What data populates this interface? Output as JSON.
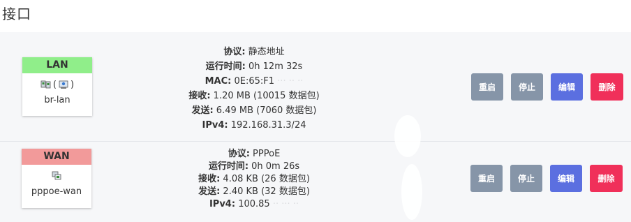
{
  "page": {
    "title": "接口"
  },
  "interfaces": [
    {
      "badge": "LAN",
      "device": "br-lan",
      "icons_suffix": "(",
      "icons_suffix_end": ")",
      "fields": [
        {
          "label": "协议:",
          "value": " 静态地址"
        },
        {
          "label": "运行时间:",
          "value": " 0h 12m 32s"
        },
        {
          "label": "MAC:",
          "value": " 0E:65:F1"
        },
        {
          "label": "接收:",
          "value": " 1.20 MB (10015 数据包)"
        },
        {
          "label": "发送:",
          "value": " 6.49 MB (7060 数据包)"
        },
        {
          "label": "IPv4:",
          "value": " 192.168.31.3/24"
        }
      ],
      "buttons": {
        "restart": "重启",
        "stop": "停止",
        "edit": "编辑",
        "delete": "删除"
      }
    },
    {
      "badge": "WAN",
      "device": "pppoe-wan",
      "fields": [
        {
          "label": "协议:",
          "value": " PPPoE"
        },
        {
          "label": "运行时间:",
          "value": " 0h 0m 26s"
        },
        {
          "label": "接收:",
          "value": " 4.08 KB (26 数据包)"
        },
        {
          "label": "发送:",
          "value": " 2.40 KB (32 数据包)"
        },
        {
          "label": "IPv4:",
          "value": " 100.85"
        }
      ],
      "buttons": {
        "restart": "重启",
        "stop": "停止",
        "edit": "编辑",
        "delete": "删除"
      }
    }
  ]
}
